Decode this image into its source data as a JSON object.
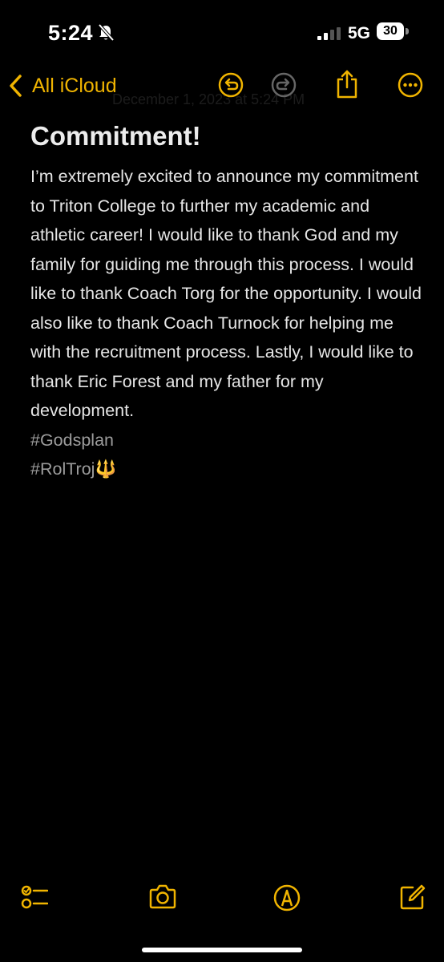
{
  "status_bar": {
    "time": "5:24",
    "network": "5G",
    "battery": "30"
  },
  "nav": {
    "back_label": "All iCloud",
    "ghost_date": "December 1, 2023 at 5:24 PM"
  },
  "note": {
    "title": "Commitment!",
    "body": "I’m extremely excited to announce my commitment to Triton College to further my academic and athletic career! I would like to thank God and my family for guiding me through this process. I would like to thank Coach Torg for the opportunity. I would also like to thank Coach Turnock for helping me with the recruitment process. Lastly, I would like to thank Eric Forest and my father for my development.",
    "hashtags": [
      "#Godsplan",
      "#RolTroj"
    ],
    "trident_emoji": "🔱"
  },
  "colors": {
    "accent": "#f0b400",
    "background": "#000000",
    "text": "#e6e6e6",
    "hashtag": "#9c9c9c"
  },
  "icons": {
    "nav": [
      "chevron-left-icon",
      "undo-icon",
      "redo-icon",
      "share-icon",
      "more-icon"
    ],
    "toolbar": [
      "checklist-icon",
      "camera-icon",
      "markup-icon",
      "compose-icon"
    ]
  }
}
